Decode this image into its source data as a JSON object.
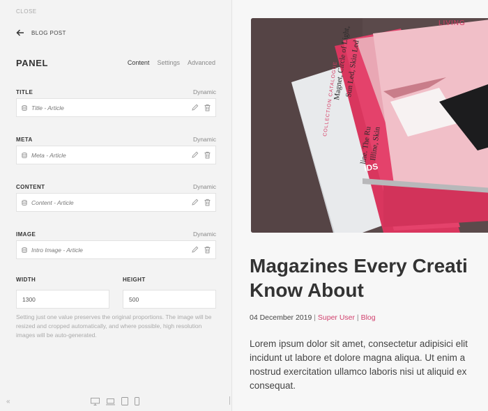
{
  "panel": {
    "close_label": "CLOSE",
    "back_label": "BLOG POST",
    "title": "PANEL",
    "tabs": [
      "Content",
      "Settings",
      "Advanced"
    ],
    "active_tab": "Content",
    "fields": [
      {
        "label": "TITLE",
        "dynamic": "Dynamic",
        "value": "Title - Article"
      },
      {
        "label": "META",
        "dynamic": "Dynamic",
        "value": "Meta - Article"
      },
      {
        "label": "CONTENT",
        "dynamic": "Dynamic",
        "value": "Content - Article"
      },
      {
        "label": "IMAGE",
        "dynamic": "Dynamic",
        "value": "Intro Image - Article"
      }
    ],
    "width": {
      "label": "WIDTH",
      "value": "1300"
    },
    "height": {
      "label": "HEIGHT",
      "value": "500"
    },
    "help": "Setting just one value preserves the original proportions. The image will be resized and cropped automatically, and where possible, high resolution images will be auto-generated.",
    "collapse_icon": "«"
  },
  "icons": {
    "back": "arrow-left-icon",
    "field": "database-icon",
    "edit": "pencil-icon",
    "delete": "trash-icon",
    "devices": [
      "desktop-icon",
      "laptop-icon",
      "tablet-icon",
      "phone-icon"
    ]
  },
  "preview": {
    "image_text": {
      "living": "LIVING",
      "catalogue": "COLLECTION CATALOGUE",
      "spine1": "Magnet, Circle of Light,",
      "spine2": "Sun Led, Skin Led",
      "spine3": "line. The Ru",
      "spine4": "Illine, Skin",
      "ids": "IDS"
    },
    "title_line1": "Magazines Every Creati",
    "title_line2": "Know About",
    "date": "04 December 2019",
    "author": "Super User",
    "category": "Blog",
    "body": [
      "Lorem ipsum dolor sit amet, consectetur adipisici elit",
      "incidunt ut labore et dolore magna aliqua. Ut enim a",
      "nostrud exercitation ullamco laboris nisi ut aliquid ex",
      "consequat."
    ]
  },
  "colors": {
    "accent": "#d1406d",
    "text": "#333333",
    "panel_bg": "#f3f3f3"
  }
}
